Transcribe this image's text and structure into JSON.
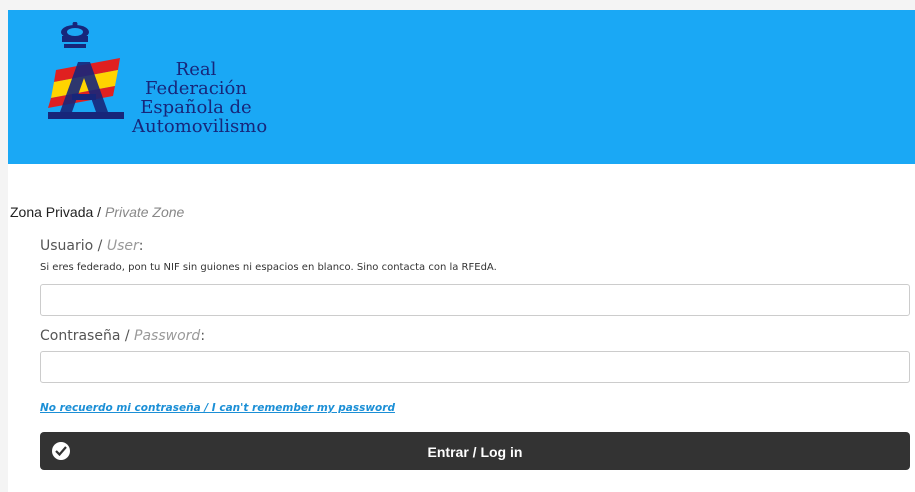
{
  "header": {
    "logo_line1": "Real Federación",
    "logo_line2": "Española de",
    "logo_line3": "Automovilismo",
    "background_color": "#1aa8f5"
  },
  "form": {
    "title_es": "Zona Privada",
    "title_sep": " / ",
    "title_en": "Private Zone",
    "user_label_es": "Usuario",
    "user_label_sep": " / ",
    "user_label_en": "User",
    "user_label_colon": ":",
    "user_hint": "Si eres federado, pon tu NIF sin guiones ni espacios en blanco. Sino contacta con la RFEdA.",
    "user_value": "",
    "password_label_es": "Contraseña",
    "password_label_sep": " / ",
    "password_label_en": "Password",
    "password_label_colon": ":",
    "password_value": "",
    "forgot_link": "No recuerdo mi contraseña / I can't remember my password",
    "login_button": "Entrar / Log in",
    "login_icon": "check-circle-icon"
  }
}
